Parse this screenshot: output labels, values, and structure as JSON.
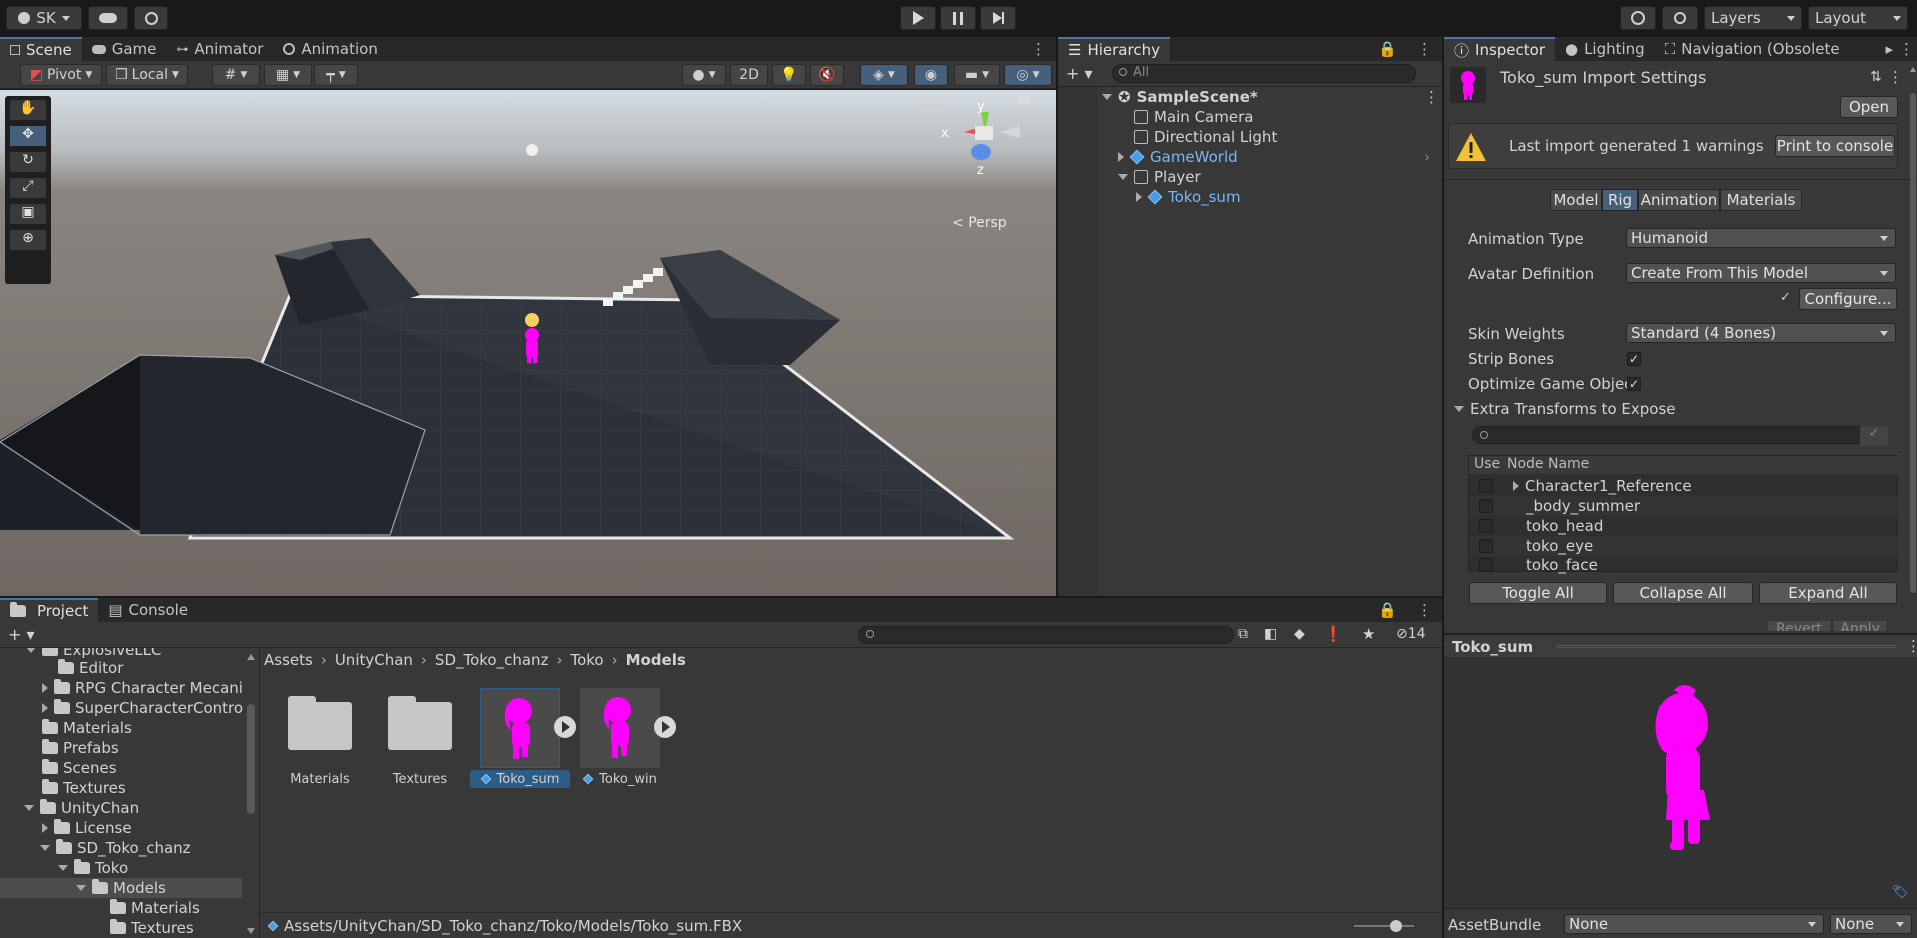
{
  "topbar": {
    "account_label": "SK",
    "layers_label": "Layers",
    "layout_label": "Layout"
  },
  "scene_panel": {
    "tabs": [
      "Scene",
      "Game",
      "Animator",
      "Animation"
    ],
    "pivot_label": "Pivot",
    "local_label": "Local",
    "mode_2d_label": "2D",
    "gizmo_view_label": "Persp",
    "axis_x": "x",
    "axis_y": "y",
    "axis_z": "z"
  },
  "hierarchy": {
    "tab": "Hierarchy",
    "search_placeholder": "All",
    "items": [
      {
        "label": "SampleScene*"
      },
      {
        "label": "Main Camera"
      },
      {
        "label": "Directional Light"
      },
      {
        "label": "GameWorld"
      },
      {
        "label": "Player"
      },
      {
        "label": "Toko_sum"
      }
    ]
  },
  "inspector": {
    "tabs": [
      "Inspector",
      "Lighting",
      "Navigation (Obsolete"
    ],
    "title": "Toko_sum Import Settings",
    "open_label": "Open",
    "warning_text": "Last import generated 1 warnings",
    "print_console_label": "Print to console",
    "subtabs": [
      "Model",
      "Rig",
      "Animation",
      "Materials"
    ],
    "animation_type_label": "Animation Type",
    "animation_type_value": "Humanoid",
    "avatar_definition_label": "Avatar Definition",
    "avatar_definition_value": "Create From This Model",
    "configure_label": "Configure...",
    "skin_weights_label": "Skin Weights",
    "skin_weights_value": "Standard (4 Bones)",
    "strip_bones_label": "Strip Bones",
    "optimize_label": "Optimize Game Objec",
    "extra_transforms_label": "Extra Transforms to Expose",
    "col_use": "Use",
    "col_node": "Node Name",
    "nodes": [
      {
        "label": "Character1_Reference"
      },
      {
        "label": "_body_summer"
      },
      {
        "label": "toko_head"
      },
      {
        "label": "toko_eye"
      },
      {
        "label": "toko_face"
      }
    ],
    "toggle_all_label": "Toggle All",
    "collapse_all_label": "Collapse All",
    "expand_all_label": "Expand All",
    "revert_label": "Revert",
    "apply_label": "Apply",
    "preview_title": "Toko_sum",
    "assetbundle_label": "AssetBundle",
    "assetbundle_value": "None",
    "assetbundle_variant": "None"
  },
  "project": {
    "tabs": [
      "Project",
      "Console"
    ],
    "hidden_count": "14",
    "tree": [
      {
        "label": "ExplosiveLLC"
      },
      {
        "label": "Editor"
      },
      {
        "label": "RPG Character Mecani"
      },
      {
        "label": "SuperCharacterControl"
      },
      {
        "label": "Materials"
      },
      {
        "label": "Prefabs"
      },
      {
        "label": "Scenes"
      },
      {
        "label": "Textures"
      },
      {
        "label": "UnityChan"
      },
      {
        "label": "License"
      },
      {
        "label": "SD_Toko_chanz"
      },
      {
        "label": "Toko"
      },
      {
        "label": "Models"
      },
      {
        "label": "Materials"
      },
      {
        "label": "Textures"
      }
    ],
    "breadcrumb": [
      "Assets",
      "UnityChan",
      "SD_Toko_chanz",
      "Toko",
      "Models"
    ],
    "assets": [
      {
        "label": "Materials"
      },
      {
        "label": "Textures"
      },
      {
        "label": "Toko_sum"
      },
      {
        "label": "Toko_win"
      }
    ],
    "path": "Assets/UnityChan/SD_Toko_chanz/Toko/Models/Toko_sum.FBX"
  },
  "colors": {
    "accent": "#3a79bb",
    "character": "#ff00ff",
    "selection": "#2c5d87"
  }
}
